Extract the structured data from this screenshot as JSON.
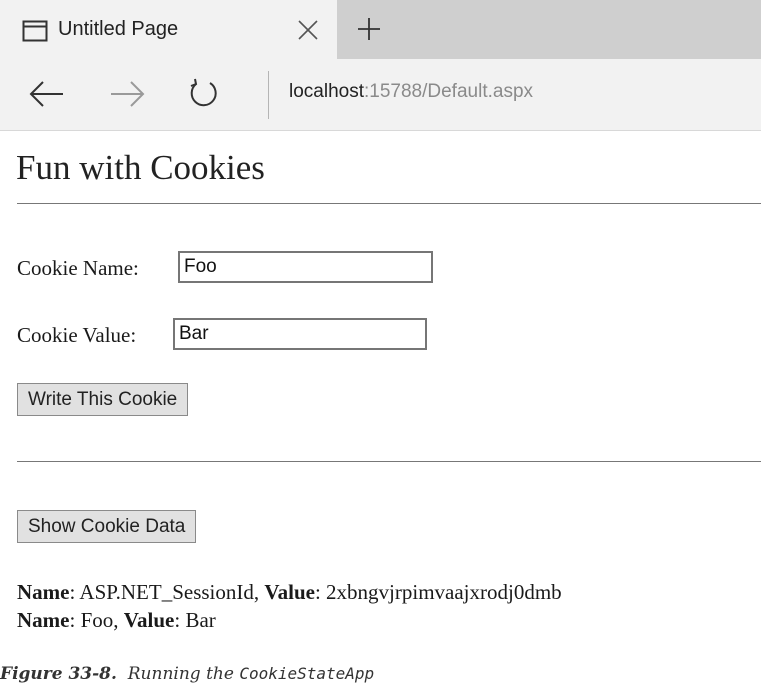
{
  "browser": {
    "tab_title": "Untitled Page",
    "url_host": "localhost",
    "url_path": ":15788/Default.aspx",
    "icons": [
      "page-icon",
      "close-icon",
      "new-tab-icon",
      "back-arrow-icon",
      "forward-arrow-icon",
      "refresh-icon"
    ]
  },
  "page": {
    "title": "Fun with Cookies",
    "cookie_name_label": "Cookie Name:",
    "cookie_name_value": "Foo",
    "cookie_value_label": "Cookie Value:",
    "cookie_value_value": "Bar",
    "write_button": "Write This Cookie",
    "show_button": "Show Cookie Data",
    "cookies": [
      {
        "name_label": "Name",
        "name": "ASP.NET_SessionId",
        "value_label": "Value",
        "value": "2xbngvjrpimvaajxrodj0dmb"
      },
      {
        "name_label": "Name",
        "name": "Foo",
        "value_label": "Value",
        "value": "Bar"
      }
    ]
  },
  "caption": {
    "figure": "Figure 33-8.",
    "text": "Running the",
    "app_name": "CookieStateApp"
  }
}
